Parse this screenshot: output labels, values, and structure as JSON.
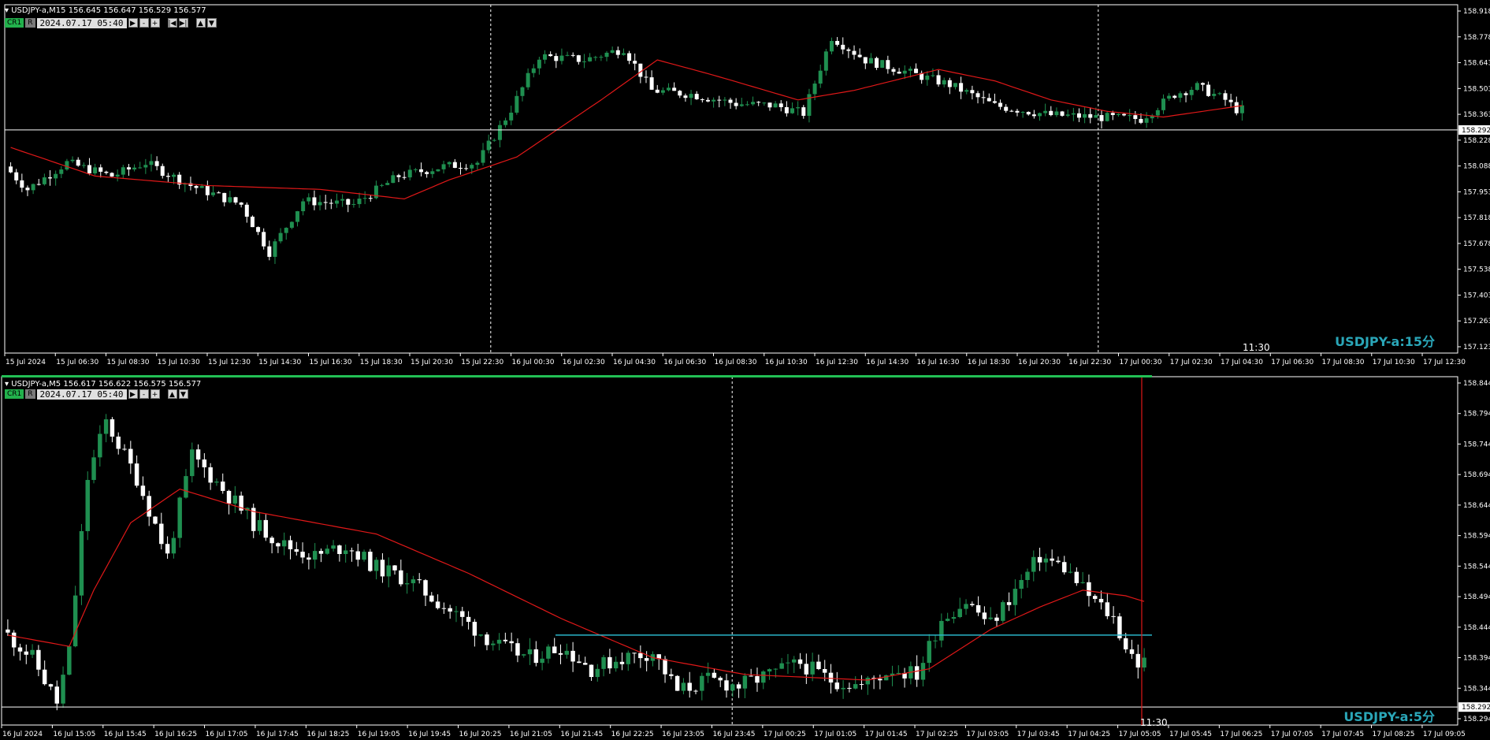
{
  "top": {
    "header": "USDJPY-a,M15  156.645 156.647 156.529 156.577",
    "cr_label": "CR1",
    "r_label": "R",
    "datetime": "2024.07.17 05:40",
    "buttons": [
      "▶",
      "-",
      "+",
      "|◀",
      "▶|",
      "▲",
      "▼"
    ],
    "watermark": "USDJPY-a:15分",
    "time_marker": "11:30",
    "chart_data": {
      "type": "candlestick",
      "ylim": [
        157.12,
        158.95
      ],
      "yticks": [
        "158.918",
        "158.778",
        "158.643",
        "158.503",
        "158.363",
        "158.228",
        "158.088",
        "157.953",
        "157.818",
        "157.678",
        "157.538",
        "157.403",
        "157.263",
        "157.123"
      ],
      "price_label": "158.292",
      "hline": 158.292,
      "xticks": [
        "15 Jul 2024",
        "15 Jul 06:30",
        "15 Jul 08:30",
        "15 Jul 10:30",
        "15 Jul 12:30",
        "15 Jul 14:30",
        "15 Jul 16:30",
        "15 Jul 18:30",
        "15 Jul 20:30",
        "15 Jul 22:30",
        "16 Jul 00:30",
        "16 Jul 02:30",
        "16 Jul 04:30",
        "16 Jul 06:30",
        "16 Jul 08:30",
        "16 Jul 10:30",
        "16 Jul 12:30",
        "16 Jul 14:30",
        "16 Jul 16:30",
        "16 Jul 18:30",
        "16 Jul 20:30",
        "16 Jul 22:30",
        "17 Jul 00:30",
        "17 Jul 02:30",
        "17 Jul 04:30",
        "17 Jul 06:30",
        "17 Jul 08:30",
        "17 Jul 10:30",
        "17 Jul 12:30"
      ],
      "vlines_at_tick": [
        9.6,
        21.6
      ],
      "anchors": [
        [
          0,
          158.1
        ],
        [
          4,
          157.98
        ],
        [
          11,
          158.12
        ],
        [
          19,
          158.05
        ],
        [
          25,
          158.12
        ],
        [
          33,
          158.0
        ],
        [
          42,
          157.9
        ],
        [
          47,
          157.65
        ],
        [
          53,
          157.92
        ],
        [
          62,
          157.9
        ],
        [
          70,
          158.05
        ],
        [
          78,
          158.1
        ],
        [
          84,
          158.12
        ],
        [
          90,
          158.4
        ],
        [
          95,
          158.68
        ],
        [
          103,
          158.66
        ],
        [
          110,
          158.72
        ],
        [
          115,
          158.5
        ],
        [
          122,
          158.48
        ],
        [
          130,
          158.43
        ],
        [
          137,
          158.42
        ],
        [
          142,
          158.38
        ],
        [
          147,
          158.78
        ],
        [
          153,
          158.66
        ],
        [
          160,
          158.6
        ],
        [
          168,
          158.53
        ],
        [
          176,
          158.42
        ],
        [
          186,
          158.37
        ],
        [
          194,
          158.36
        ],
        [
          202,
          158.35
        ],
        [
          208,
          158.48
        ],
        [
          212,
          158.52
        ],
        [
          217,
          158.45
        ],
        [
          219,
          158.4
        ]
      ],
      "ma_anchors": [
        [
          0,
          158.2
        ],
        [
          15,
          158.05
        ],
        [
          35,
          158.0
        ],
        [
          55,
          157.98
        ],
        [
          70,
          157.93
        ],
        [
          78,
          158.03
        ],
        [
          90,
          158.15
        ],
        [
          105,
          158.45
        ],
        [
          115,
          158.66
        ],
        [
          125,
          158.58
        ],
        [
          140,
          158.45
        ],
        [
          150,
          158.5
        ],
        [
          165,
          158.61
        ],
        [
          175,
          158.55
        ],
        [
          185,
          158.45
        ],
        [
          195,
          158.39
        ],
        [
          205,
          158.36
        ],
        [
          219,
          158.42
        ]
      ],
      "count": 220
    }
  },
  "bottom": {
    "header": "USDJPY-a,M5  156.617 156.622 156.575 156.577",
    "cr_label": "CR1",
    "r_label": "R",
    "datetime": "2024.07.17 05:40",
    "buttons": [
      "▶",
      "-",
      "+",
      "▲",
      "▼"
    ],
    "watermark": "USDJPY-a:5分",
    "time_marker": "11:30",
    "chart_data": {
      "type": "candlestick",
      "ylim": [
        158.26,
        158.88
      ],
      "yticks": [
        "158.844",
        "158.794",
        "158.744",
        "158.694",
        "158.644",
        "158.594",
        "158.544",
        "158.494",
        "158.444",
        "158.394",
        "158.344",
        "158.294"
      ],
      "price_label": "158.292",
      "hline": 158.292,
      "cyan_line": 158.42,
      "xticks": [
        "16 Jul 2024",
        "16 Jul 15:05",
        "16 Jul 15:45",
        "16 Jul 16:25",
        "16 Jul 17:05",
        "16 Jul 17:45",
        "16 Jul 18:25",
        "16 Jul 19:05",
        "16 Jul 19:45",
        "16 Jul 20:25",
        "16 Jul 21:05",
        "16 Jul 21:45",
        "16 Jul 22:25",
        "16 Jul 23:05",
        "16 Jul 23:45",
        "17 Jul 00:25",
        "17 Jul 01:05",
        "17 Jul 01:45",
        "17 Jul 02:25",
        "17 Jul 03:05",
        "17 Jul 03:45",
        "17 Jul 04:25",
        "17 Jul 05:05",
        "17 Jul 05:45",
        "17 Jul 06:25",
        "17 Jul 07:05",
        "17 Jul 07:45",
        "17 Jul 08:25",
        "17 Jul 09:05"
      ],
      "vlines_at_tick": [
        14.4
      ],
      "anchors": [
        [
          0,
          158.43
        ],
        [
          5,
          158.38
        ],
        [
          9,
          158.3
        ],
        [
          11,
          158.39
        ],
        [
          14,
          158.7
        ],
        [
          17,
          158.8
        ],
        [
          22,
          158.7
        ],
        [
          27,
          158.56
        ],
        [
          31,
          158.74
        ],
        [
          36,
          158.68
        ],
        [
          41,
          158.62
        ],
        [
          46,
          158.58
        ],
        [
          51,
          158.56
        ],
        [
          56,
          158.58
        ],
        [
          61,
          158.54
        ],
        [
          66,
          158.52
        ],
        [
          71,
          158.48
        ],
        [
          76,
          158.44
        ],
        [
          81,
          158.4
        ],
        [
          86,
          158.38
        ],
        [
          91,
          158.4
        ],
        [
          96,
          158.36
        ],
        [
          101,
          158.38
        ],
        [
          106,
          158.39
        ],
        [
          110,
          158.32
        ],
        [
          115,
          158.34
        ],
        [
          120,
          158.33
        ],
        [
          125,
          158.35
        ],
        [
          130,
          158.37
        ],
        [
          135,
          158.34
        ],
        [
          140,
          158.33
        ],
        [
          145,
          158.36
        ],
        [
          149,
          158.35
        ],
        [
          153,
          158.45
        ],
        [
          157,
          158.48
        ],
        [
          161,
          158.44
        ],
        [
          165,
          158.5
        ],
        [
          169,
          158.56
        ],
        [
          173,
          158.54
        ],
        [
          177,
          158.49
        ],
        [
          181,
          158.45
        ],
        [
          183,
          158.4
        ],
        [
          185,
          158.37
        ]
      ],
      "ma_anchors": [
        [
          0,
          158.42
        ],
        [
          10,
          158.4
        ],
        [
          14,
          158.5
        ],
        [
          20,
          158.62
        ],
        [
          28,
          158.68
        ],
        [
          40,
          158.64
        ],
        [
          60,
          158.6
        ],
        [
          75,
          158.53
        ],
        [
          90,
          158.45
        ],
        [
          105,
          158.38
        ],
        [
          120,
          158.35
        ],
        [
          140,
          158.34
        ],
        [
          150,
          158.36
        ],
        [
          160,
          158.43
        ],
        [
          168,
          158.47
        ],
        [
          175,
          158.5
        ],
        [
          182,
          158.49
        ],
        [
          185,
          158.48
        ]
      ],
      "count": 186
    }
  }
}
